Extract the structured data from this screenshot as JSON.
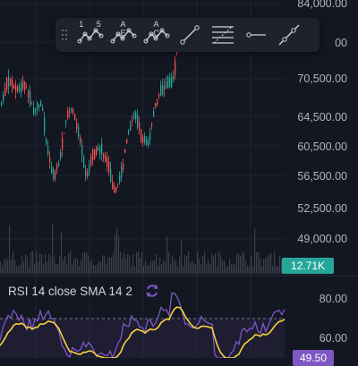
{
  "toolbar": {
    "tools": [
      {
        "name": "drag-handle",
        "label": ""
      },
      {
        "name": "pattern-15-icon",
        "label": "1 5"
      },
      {
        "name": "pattern-ae-icon",
        "label": "A E"
      },
      {
        "name": "pattern-ac-icon",
        "label": "A C"
      },
      {
        "name": "trend-line-icon",
        "label": ""
      },
      {
        "name": "fib-levels-icon",
        "label": ""
      },
      {
        "name": "horizontal-ray-icon",
        "label": ""
      },
      {
        "name": "extended-line-icon",
        "label": ""
      }
    ]
  },
  "price_axis": {
    "labels": [
      "84,000.00",
      "00",
      "70,500.00",
      "64,500.00",
      "60,500.00",
      "56,500.00",
      "52,500.00",
      "49,000.00"
    ]
  },
  "volume_badge": "12.71K",
  "rsi": {
    "title": "RSI 14 close SMA 14 2",
    "ticks": [
      "80.00",
      "60.00"
    ],
    "current_badge": "49.50"
  },
  "colors": {
    "background": "#131722",
    "up": "#26a69a",
    "down": "#ef5350",
    "rsi_line": "#7e57c2",
    "rsi_sma": "#f5d33b",
    "toolbar_bg": "#1e222d"
  }
}
